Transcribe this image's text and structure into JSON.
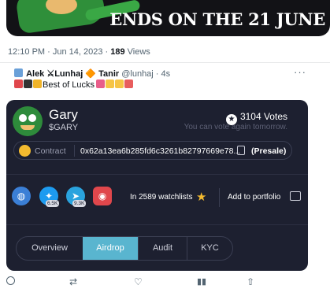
{
  "banner": {
    "text": "ENDS ON THE 21 JUNE"
  },
  "meta": {
    "time": "12:10 PM · Jun 14, 2023",
    "sep": " · ",
    "views_count": "189",
    "views_label": " Views"
  },
  "reply": {
    "display_name": "Alek ⚔Lunhaj 🔶 Tanir",
    "handle": "@lunhaj · 4s",
    "text": "Best of Lucks",
    "more": "···"
  },
  "card": {
    "name": "Gary",
    "ticker": "$GARY",
    "votes": "3104 Votes",
    "vote_hint": "You can vote again tomorrow.",
    "contract_label": "Contract",
    "contract_address": "0x62a13ea6b285fd6c3261b82797669e78...",
    "contract_status": "(Presale)",
    "socials": [
      {
        "name": "website",
        "badge": ""
      },
      {
        "name": "twitter",
        "badge": "6.5K"
      },
      {
        "name": "telegram",
        "badge": "9.3K"
      },
      {
        "name": "instagram",
        "badge": ""
      }
    ],
    "watchlists": "In 2589 watchlists",
    "add_to_portfolio": "Add to portfolio",
    "tabs": [
      {
        "label": "Overview",
        "active": false
      },
      {
        "label": "Airdrop",
        "active": true
      },
      {
        "label": "Audit",
        "active": false
      },
      {
        "label": "KYC",
        "active": false
      }
    ]
  },
  "actions": [
    "reply",
    "retweet",
    "like",
    "views",
    "share"
  ],
  "colors": {
    "card_bg": "#1d2030",
    "active_tab": "#59b5cf",
    "star": "#f3ba2f"
  }
}
